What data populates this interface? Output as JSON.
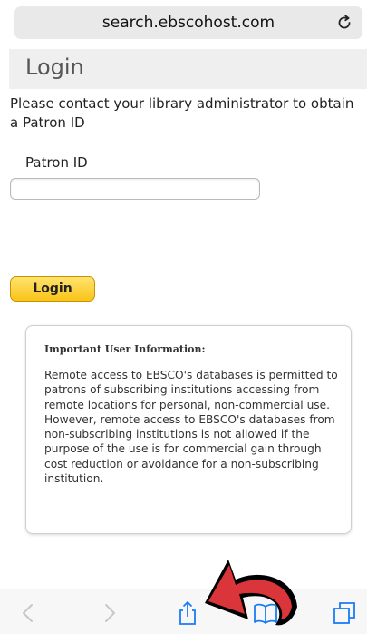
{
  "browser": {
    "url": "search.ebscohost.com",
    "reload_icon": "reload-icon"
  },
  "header": {
    "title": "Login"
  },
  "form": {
    "instruction": "Please contact your library administrator to obtain a Patron ID",
    "patron_label": "Patron ID",
    "patron_value": "",
    "login_button": "Login"
  },
  "info": {
    "title": "Important User Information:",
    "body": "Remote access to EBSCO's databases is permitted to patrons of subscribing institutions accessing from remote locations for personal, non-commercial use. However, remote access to EBSCO's databases from non-subscribing institutions is not allowed if the purpose of the use is for commercial gain through cost reduction or avoidance for a non-subscribing institution."
  },
  "toolbar": {
    "icons": [
      "back-icon",
      "forward-icon",
      "share-icon",
      "bookmarks-icon",
      "tabs-icon"
    ]
  },
  "colors": {
    "button_top": "#ffe36e",
    "button_bottom": "#f9c419",
    "toolbar_tint": "#1a7cf5",
    "annotation_arrow": "#d9353a"
  }
}
